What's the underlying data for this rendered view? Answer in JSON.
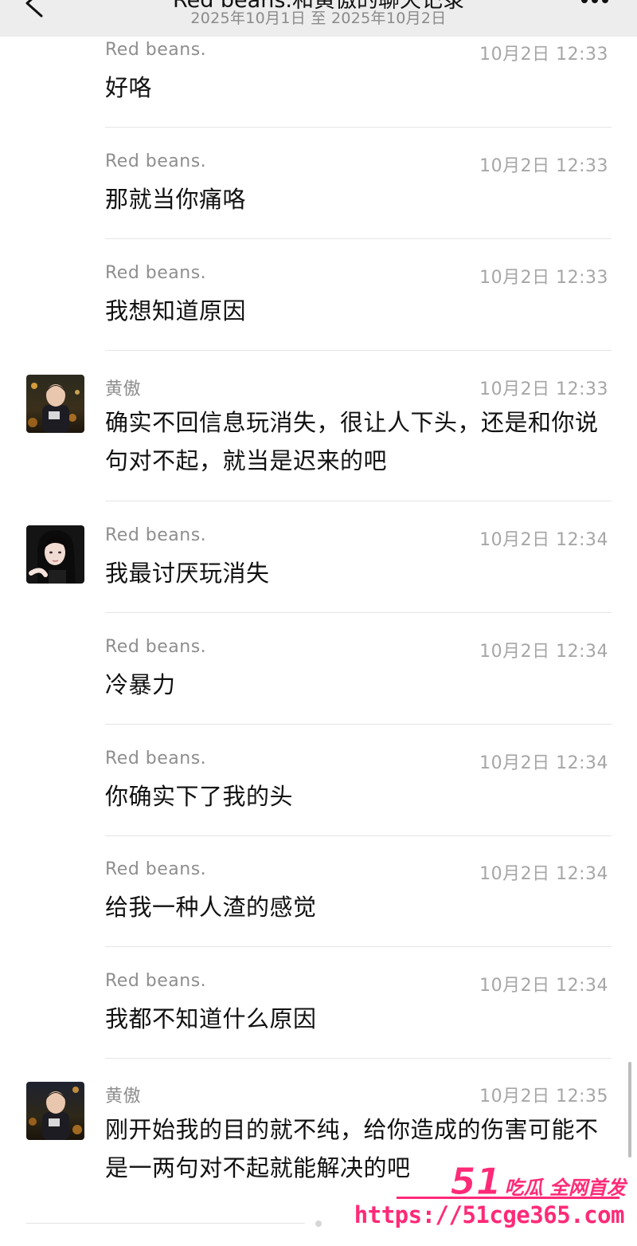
{
  "header": {
    "title": "Red beans.和黄傲的聊天记录",
    "subtitle": "2025年10月1日 至 2025年10月2日",
    "back_icon": "chevron-left-icon",
    "more_icon": "more-dots-icon"
  },
  "messages": [
    {
      "sender": "Red  beans.",
      "time": "10月2日 12:33",
      "text": "好咯"
    },
    {
      "sender": "Red  beans.",
      "time": "10月2日 12:33",
      "text": "那就当你痛咯"
    },
    {
      "sender": "Red  beans.",
      "time": "10月2日 12:33",
      "text": "我想知道原因"
    },
    {
      "sender": "黄傲",
      "time": "10月2日 12:33",
      "text": "确实不回信息玩消失，很让人下头，还是和你说句对不起，就当是迟来的吧"
    },
    {
      "sender": "Red  beans.",
      "time": "10月2日 12:34",
      "text": "我最讨厌玩消失"
    },
    {
      "sender": "Red  beans.",
      "time": "10月2日 12:34",
      "text": "冷暴力"
    },
    {
      "sender": "Red  beans.",
      "time": "10月2日 12:34",
      "text": "你确实下了我的头"
    },
    {
      "sender": "Red  beans.",
      "time": "10月2日 12:34",
      "text": "给我一种人渣的感觉"
    },
    {
      "sender": "Red  beans.",
      "time": "10月2日 12:34",
      "text": "我都不知道什么原因"
    },
    {
      "sender": "黄傲",
      "time": "10月2日 12:35",
      "text": "刚开始我的目的就不纯，给你造成的伤害可能不是一两句对不起就能解决的吧"
    }
  ],
  "watermark": {
    "number": "51",
    "brand": "吃瓜 全网首发",
    "url": "https://51cge365.com"
  }
}
